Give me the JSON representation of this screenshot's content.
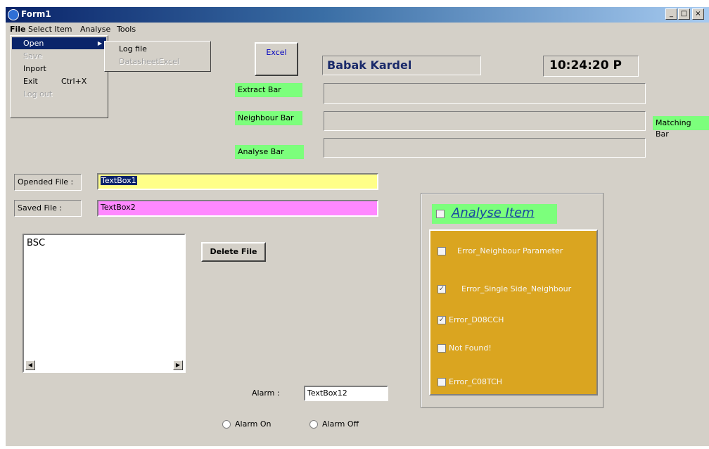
{
  "window": {
    "title": "Form1",
    "minimize": "_",
    "maximize": "□",
    "close": "×"
  },
  "menu": {
    "file": "File",
    "select_item": "Select Item",
    "analyse": "Analyse",
    "tools": "Tools"
  },
  "file_menu": {
    "open": "Open",
    "open_arrow": "▶",
    "save": "Save",
    "import": "Inport",
    "exit": "Exit",
    "exit_shortcut": "Ctrl+X",
    "logout": "Log out"
  },
  "open_submenu": {
    "log_file": "Log file",
    "datasheet": "DatasheetExcel"
  },
  "buttons": {
    "excel": "Excel",
    "delete_file": "Delete File"
  },
  "header": {
    "user_name": "Babak Kardel",
    "clock": "10:24:20 P"
  },
  "bars": {
    "extract": "Extract Bar",
    "neighbour": "Neighbour Bar",
    "analyse": "Analyse Bar",
    "matching": "Matching Bar"
  },
  "files": {
    "opened_label": "Opended File :",
    "opened_value": "TextBox1",
    "saved_label": "Saved File :",
    "saved_value": "TextBox2"
  },
  "listbox": {
    "items": [
      "BSC"
    ],
    "scroll_left": "◀",
    "scroll_right": "▶"
  },
  "analyse_panel": {
    "title": "Analyse Item",
    "items": [
      {
        "label": "Error_Neighbour Parameter",
        "checked": false,
        "mark": ""
      },
      {
        "label": "Error_Single Side_Neighbour",
        "checked": true,
        "mark": "✓"
      },
      {
        "label": "Error_D08CCH",
        "checked": true,
        "mark": "✓"
      },
      {
        "label": "Not Found!",
        "checked": false,
        "mark": ""
      },
      {
        "label": "Error_C08TCH",
        "checked": false,
        "mark": ""
      }
    ]
  },
  "alarm": {
    "label": "Alarm :",
    "value": "TextBox12",
    "on_label": "Alarm On",
    "off_label": "Alarm Off"
  },
  "colors": {
    "window_bg": "#d4d0c8",
    "title_dark": "#0a246a",
    "green_label": "#7cff7c",
    "opened_bg": "#ffff88",
    "saved_bg": "#ff88ff",
    "panel_orange": "#daa520",
    "name_color": "#1a2a6a"
  }
}
